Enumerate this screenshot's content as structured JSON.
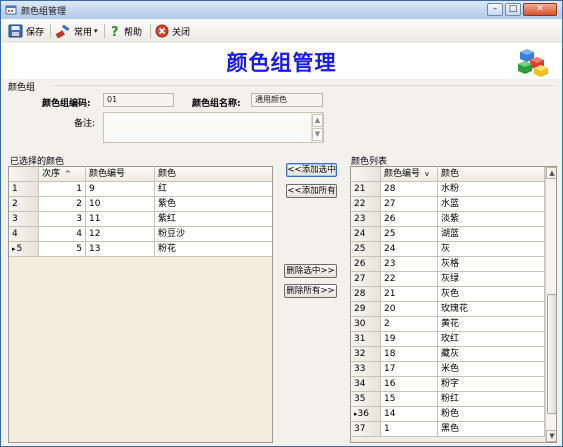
{
  "window": {
    "title": "颜色组管理",
    "controls": {
      "minimize": "–",
      "maximize": "□",
      "close": "✕"
    }
  },
  "toolbar": {
    "save": "保存",
    "common": "常用",
    "help": "帮助",
    "close": "关闭"
  },
  "header": {
    "title": "颜色组管理"
  },
  "group": {
    "legend": "颜色组",
    "code_label": "颜色组编码:",
    "code_value": "01",
    "name_label": "颜色组名称:",
    "name_value": "通用颜色",
    "remark_label": "备注:"
  },
  "selected": {
    "label": "已选择的颜色",
    "columns": [
      "次序",
      "颜色编号",
      "颜色"
    ],
    "sort_indicator": "^",
    "rows": [
      {
        "row": "1",
        "order": "1",
        "code": "9",
        "color": "红"
      },
      {
        "row": "2",
        "order": "2",
        "code": "10",
        "color": "紫色"
      },
      {
        "row": "3",
        "order": "3",
        "code": "11",
        "color": "紫红"
      },
      {
        "row": "4",
        "order": "4",
        "code": "12",
        "color": "粉豆沙"
      },
      {
        "row": "5",
        "order": "5",
        "code": "13",
        "color": "粉花",
        "current": true
      }
    ]
  },
  "actions": {
    "add_selected": "<<添加选中",
    "add_all": "<<添加所有",
    "remove_selected": "删除选中>>",
    "remove_all": "删除所有>>"
  },
  "list": {
    "label": "颜色列表",
    "columns": [
      "颜色编号",
      "颜色"
    ],
    "sort_indicator": "v",
    "rows": [
      {
        "row": "21",
        "code": "28",
        "color": "水粉"
      },
      {
        "row": "22",
        "code": "27",
        "color": "水蓝"
      },
      {
        "row": "23",
        "code": "26",
        "color": "淡紫"
      },
      {
        "row": "24",
        "code": "25",
        "color": "湖蓝"
      },
      {
        "row": "25",
        "code": "24",
        "color": "灰"
      },
      {
        "row": "26",
        "code": "23",
        "color": "灰格"
      },
      {
        "row": "27",
        "code": "22",
        "color": "灰绿"
      },
      {
        "row": "28",
        "code": "21",
        "color": "灰色"
      },
      {
        "row": "29",
        "code": "20",
        "color": "玫瑰花"
      },
      {
        "row": "30",
        "code": "2",
        "color": "黄花"
      },
      {
        "row": "31",
        "code": "19",
        "color": "玫红"
      },
      {
        "row": "32",
        "code": "18",
        "color": "藏灰"
      },
      {
        "row": "33",
        "code": "17",
        "color": "米色"
      },
      {
        "row": "34",
        "code": "16",
        "color": "粉字"
      },
      {
        "row": "35",
        "code": "15",
        "color": "粉红"
      },
      {
        "row": "36",
        "code": "14",
        "color": "粉色",
        "current": true
      },
      {
        "row": "37",
        "code": "1",
        "color": "黑色"
      }
    ],
    "scroll_position": 0.88
  },
  "colors": {
    "title_blue": "#1a1ae6",
    "grid_bg": "#f3ede0"
  },
  "icons": [
    "app-icon",
    "save-icon",
    "common-icon",
    "help-icon",
    "close-icon",
    "color-cubes-icon"
  ]
}
